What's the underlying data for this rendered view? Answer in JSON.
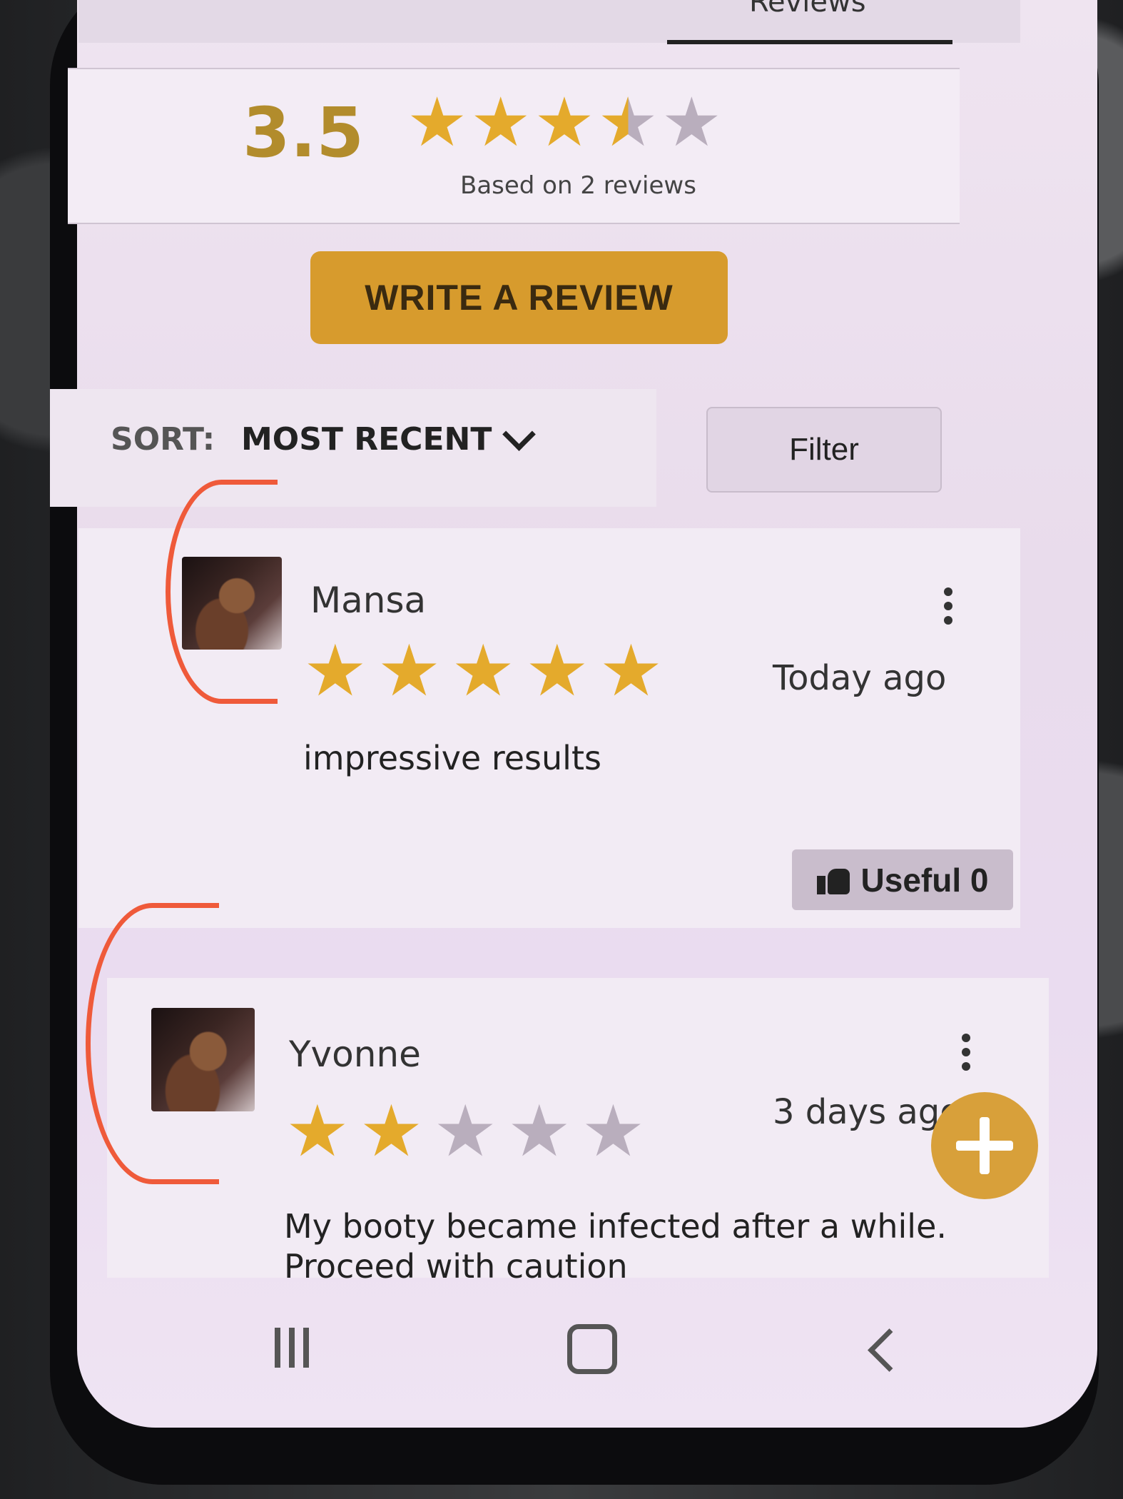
{
  "tab": {
    "label": "Reviews"
  },
  "summary": {
    "average": "3.5",
    "rating_value": 3.5,
    "rating_max": 5,
    "based_on": "Based on 2 reviews"
  },
  "write_review": {
    "label": "WRITE A REVIEW"
  },
  "sort": {
    "label": "SORT:",
    "value": "MOST RECENT"
  },
  "filter": {
    "label": "Filter"
  },
  "reviews": [
    {
      "name": "Mansa",
      "stars": 5,
      "time": "Today ago",
      "text": "impressive results",
      "useful_label": "Useful 0"
    },
    {
      "name": "Yvonne",
      "stars": 2,
      "time": "3 days ago",
      "text": "My booty became infected after a while. Proceed with caution"
    }
  ],
  "colors": {
    "accent": "#d79b2d",
    "star_on": "#e4aa2c",
    "star_off": "#b9aebd",
    "annotation": "#ef5a3a"
  },
  "icons": {
    "more": "more-vertical-icon",
    "thumb": "thumbs-up-icon",
    "fab": "plus-icon"
  }
}
